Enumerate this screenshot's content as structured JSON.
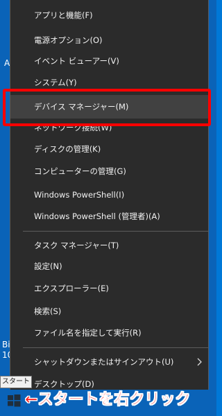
{
  "desktop": {
    "edge_text_1": "A",
    "edge_text_2": "Bi",
    "edge_text_3": "10"
  },
  "menu": {
    "items": [
      {
        "label": "アプリと機能(F)"
      },
      {
        "label": "電源オプション(O)"
      },
      {
        "label": "イベント ビューアー(V)"
      },
      {
        "label": "システム(Y)"
      },
      {
        "label": "デバイス マネージャー(M)"
      },
      {
        "label": "ネットワーク接続(W)"
      },
      {
        "label": "ディスクの管理(K)"
      },
      {
        "label": "コンピューターの管理(G)"
      },
      {
        "label": "Windows PowerShell(I)"
      },
      {
        "label": "Windows PowerShell (管理者)(A)"
      },
      {
        "label": "タスク マネージャー(T)"
      },
      {
        "label": "設定(N)"
      },
      {
        "label": "エクスプローラー(E)"
      },
      {
        "label": "検索(S)"
      },
      {
        "label": "ファイル名を指定して実行(R)"
      },
      {
        "label": "シャットダウンまたはサインアウト(U)"
      },
      {
        "label": "デスクトップ(D)"
      }
    ],
    "selected_label": "デバイス マネージャー(M)"
  },
  "tooltip": {
    "text": "スタート"
  },
  "annotation": {
    "caption": "←スタートを右クリック",
    "highlight_color": "#ff0000"
  },
  "colors": {
    "menu_bg": "#2b2b2b",
    "menu_text": "#f2f2f2",
    "desktop_bg": "#0a63b8",
    "caption": "#ff1a1a"
  }
}
